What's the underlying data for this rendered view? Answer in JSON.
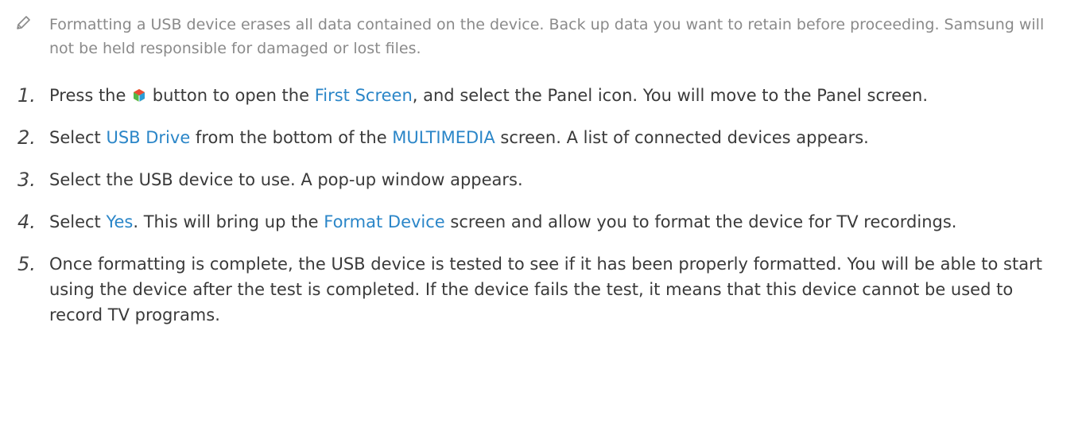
{
  "note": {
    "icon": "pencil-icon",
    "text": "Formatting a USB device erases all data contained on the device. Back up data you want to retain before proceeding. Samsung will not be held responsible for damaged or lost files."
  },
  "accent_color": "#2b86c8",
  "steps": [
    {
      "number": "1.",
      "before": "Press the ",
      "icon": "smart-hub-icon",
      "after": " button to open the ",
      "kw1": "First Screen",
      "after2": ", and select the Panel icon. You will move to the Panel screen."
    },
    {
      "number": "2.",
      "before": "Select ",
      "kw1": "USB Drive",
      "mid": " from the bottom of the ",
      "kw2": "MULTIMEDIA",
      "after": " screen. A list of connected devices appears."
    },
    {
      "number": "3.",
      "text": "Select the USB device to use. A pop-up window appears."
    },
    {
      "number": "4.",
      "before": "Select ",
      "kw1": "Yes",
      "mid": ". This will bring up the ",
      "kw2": "Format Device",
      "after": " screen and allow you to format the device for TV recordings."
    },
    {
      "number": "5.",
      "text": "Once formatting is complete, the USB device is tested to see if it has been properly formatted. You will be able to start using the device after the test is completed. If the device fails the test, it means that this device cannot be used to record TV programs."
    }
  ]
}
